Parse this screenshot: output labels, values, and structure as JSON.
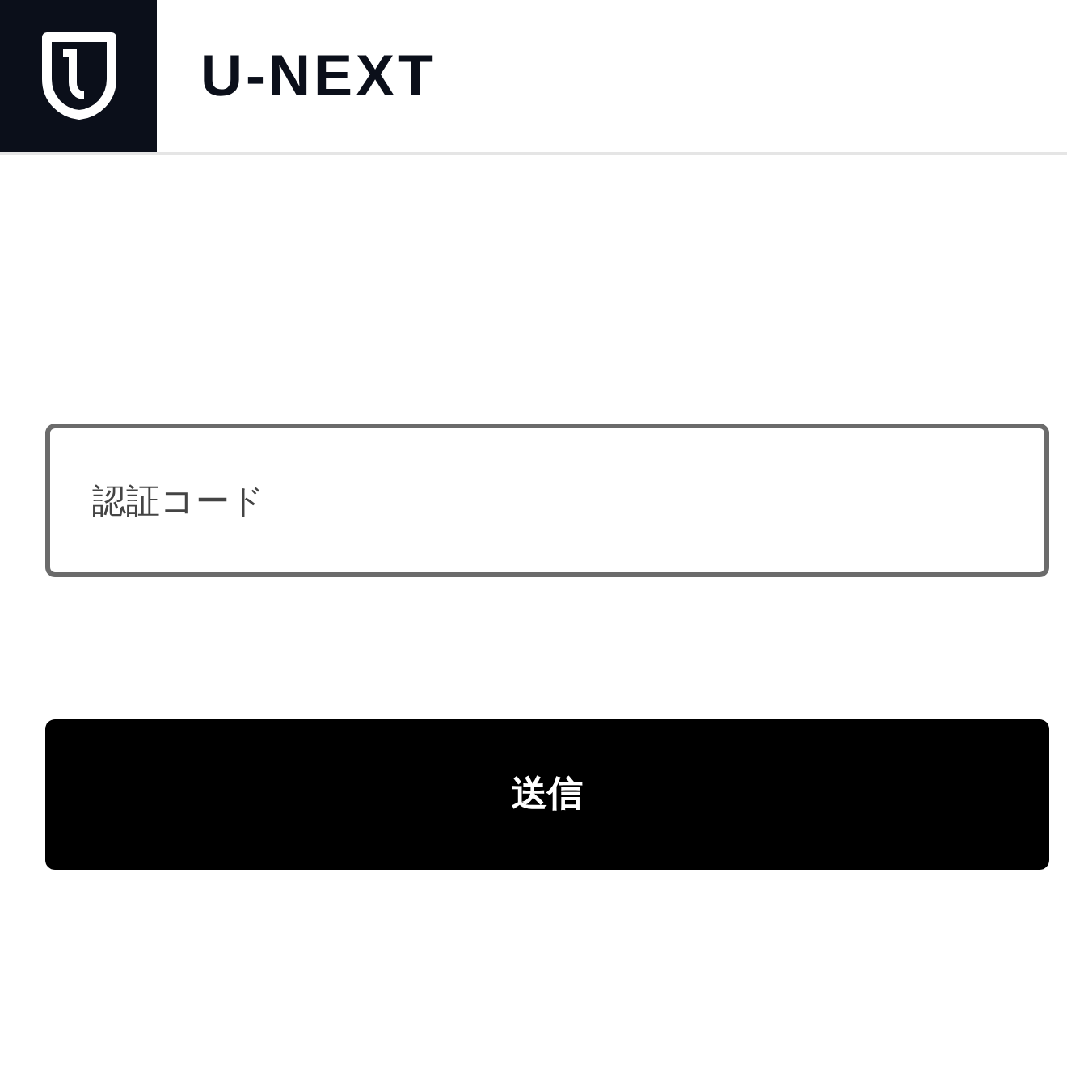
{
  "header": {
    "logo_text": "U-NEXT"
  },
  "code_field": {
    "placeholder": "認証コード"
  },
  "submit_button": {
    "label": "送信"
  }
}
